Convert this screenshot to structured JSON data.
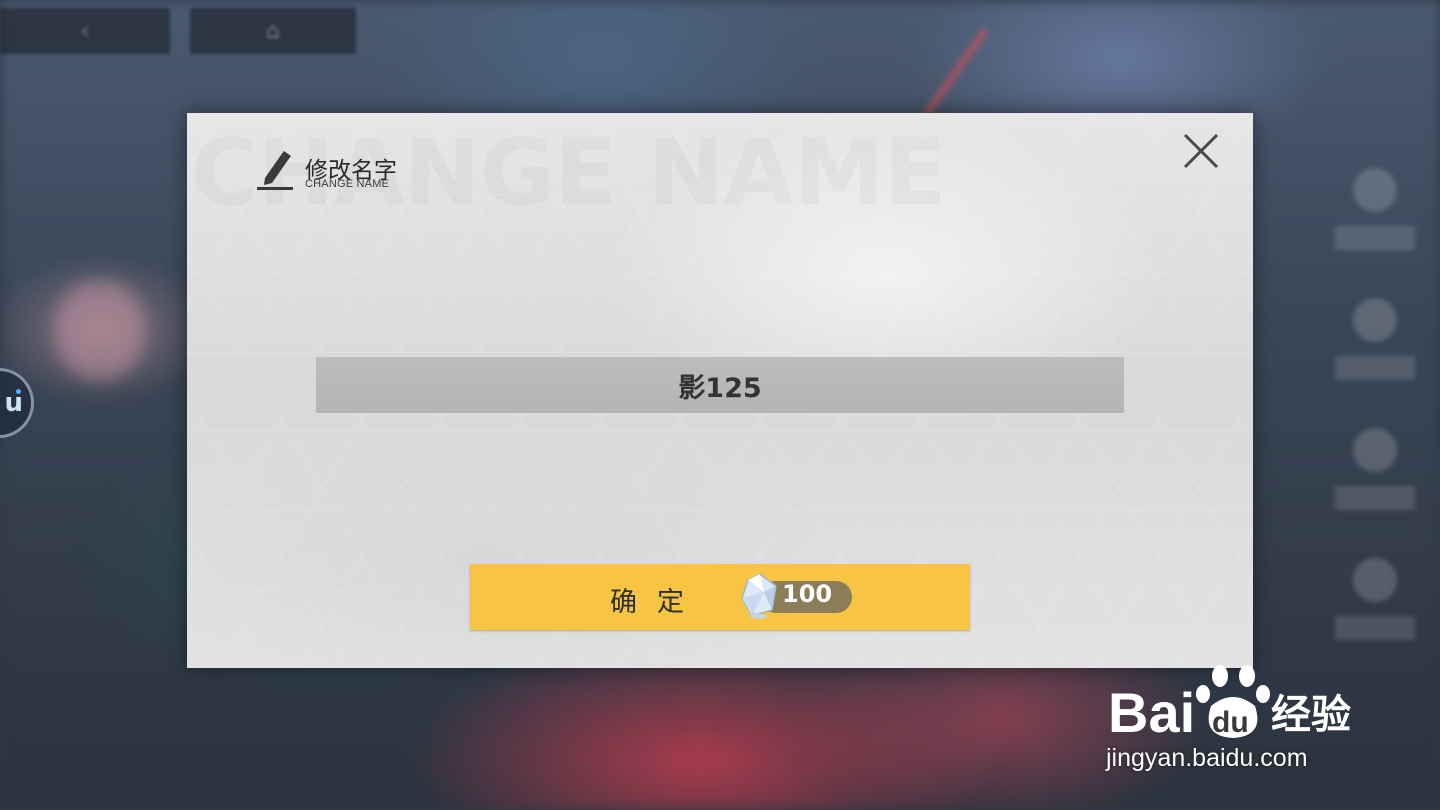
{
  "dialog": {
    "title_cn": "修改名字",
    "title_en": "CHANGE NAME",
    "watermark_title": "CHANGE NAME",
    "name_value": "影125",
    "confirm_label": "确定",
    "cost": "100",
    "close_icon": "close-icon",
    "edit_icon": "pencil-icon",
    "currency_icon": "crystal-icon"
  },
  "colors": {
    "confirm_button": "#f7c443",
    "cost_pill": "#8b7d58",
    "dialog_bg": "#e0e0e0",
    "input_bg": "#b8b8b8"
  },
  "watermark": {
    "brand_latin": "Bai",
    "brand_du": "du",
    "brand_cn": "经验",
    "url": "jingyan.baidu.com"
  }
}
